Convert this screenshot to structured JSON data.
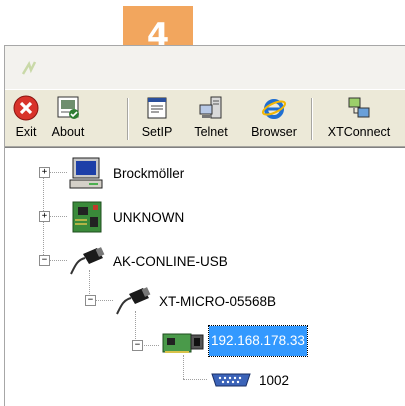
{
  "callout": {
    "number": "4",
    "color": "#f2a65e"
  },
  "toolbar": {
    "exit_label": "Exit",
    "about_label": "About",
    "setip_label": "SetIP",
    "telnet_label": "Telnet",
    "browser_label": "Browser",
    "xtconnect_label": "XTConnect"
  },
  "tree": {
    "items": [
      {
        "label": "Brockmöller",
        "icon": "computer-icon",
        "expander": "+"
      },
      {
        "label": "UNKNOWN",
        "icon": "circuit-board-icon",
        "expander": "+"
      },
      {
        "label": "AK-CONLINE-USB",
        "icon": "usb-adapter-icon",
        "expander": "−"
      },
      {
        "label": "XT-MICRO-05568B",
        "icon": "usb-adapter-icon",
        "expander": "−"
      },
      {
        "label": "192.168.178.33",
        "icon": "network-card-icon",
        "expander": "−",
        "selected": true
      },
      {
        "label": "1002",
        "icon": "serial-port-icon"
      }
    ]
  },
  "colors": {
    "selection": "#3399ff",
    "toolbar_bg": "#ece9d8"
  }
}
